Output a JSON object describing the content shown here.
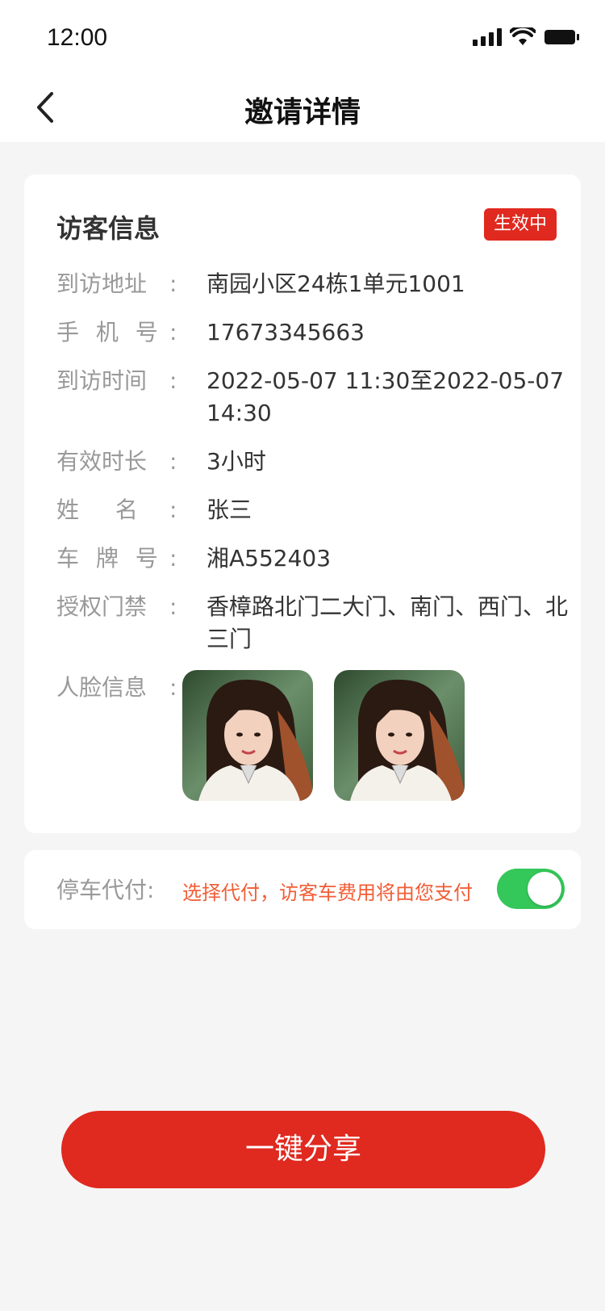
{
  "status_bar": {
    "time": "12:00"
  },
  "nav": {
    "title": "邀请详情"
  },
  "visitor": {
    "title": "访客信息",
    "status": "生效中",
    "rows": [
      {
        "label": "到访地址",
        "value": "南园小区24栋1单元1001"
      },
      {
        "label": "手 机 号",
        "value": "17673345663"
      },
      {
        "label": "到访时间",
        "value": "2022-05-07 11:30至2022-05-07 14:30"
      },
      {
        "label": "有效时长",
        "value": "3小时"
      },
      {
        "label": "姓 名",
        "value": "张三"
      },
      {
        "label": "车 牌 号",
        "value": "湘A552403"
      },
      {
        "label": "授权门禁",
        "value": "香樟路北门二大门、南门、西门、北三门"
      },
      {
        "label": "人脸信息",
        "value": ""
      }
    ],
    "colon": ":"
  },
  "parking": {
    "label": "停车代付",
    "colon": ":",
    "note": "选择代付，访客车费用将由您支付",
    "enabled": true,
    "toggle_color": "#34c759"
  },
  "share_button": "一键分享",
  "colors": {
    "accent": "#e0291f",
    "note": "#f25d36"
  }
}
